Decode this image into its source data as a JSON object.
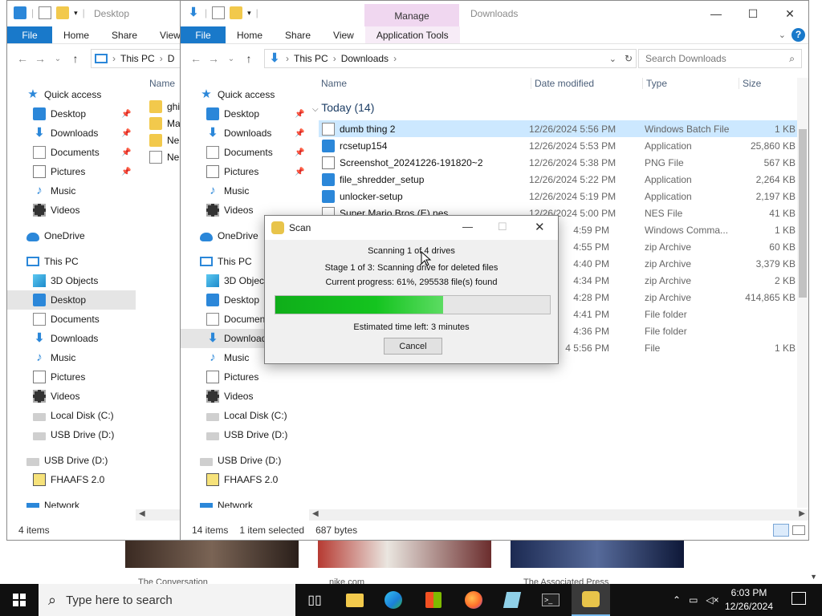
{
  "back_window": {
    "title": "Desktop",
    "ribbon": {
      "file": "File",
      "tabs": [
        "Home",
        "Share",
        "View"
      ]
    },
    "address": {
      "segments": [
        "This PC",
        "D"
      ]
    },
    "column_name": "Name",
    "files": [
      {
        "name": "ghi",
        "icon": "folder-icon"
      },
      {
        "name": "Ma",
        "icon": "folder-icon"
      },
      {
        "name": "Ne",
        "icon": "folder-icon"
      },
      {
        "name": "Ne",
        "icon": "document-icon"
      }
    ],
    "status": "4 items"
  },
  "front_window": {
    "title": "Downloads",
    "manage_label": "Manage",
    "ribbon": {
      "file": "File",
      "tabs": [
        "Home",
        "Share",
        "View",
        "Application Tools"
      ]
    },
    "address": {
      "segments": [
        "This PC",
        "Downloads"
      ]
    },
    "search_placeholder": "Search Downloads",
    "columns": {
      "name": "Name",
      "date": "Date modified",
      "type": "Type",
      "size": "Size"
    },
    "group_label": "Today (14)",
    "files": [
      {
        "name": "dumb thing 2",
        "date": "12/26/2024 5:56 PM",
        "type": "Windows Batch File",
        "size": "1 KB",
        "icon": "batch-file-icon",
        "selected": true
      },
      {
        "name": "rcsetup154",
        "date": "12/26/2024 5:53 PM",
        "type": "Application",
        "size": "25,860 KB",
        "icon": "setup-icon"
      },
      {
        "name": "Screenshot_20241226-191820~2",
        "date": "12/26/2024 5:38 PM",
        "type": "PNG File",
        "size": "567 KB",
        "icon": "image-file-icon"
      },
      {
        "name": "file_shredder_setup",
        "date": "12/26/2024 5:22 PM",
        "type": "Application",
        "size": "2,264 KB",
        "icon": "setup-icon"
      },
      {
        "name": "unlocker-setup",
        "date": "12/26/2024 5:19 PM",
        "type": "Application",
        "size": "2,197 KB",
        "icon": "setup-icon"
      },
      {
        "name": "Super Mario Bros (E).nes",
        "date": "12/26/2024 5:00 PM",
        "type": "NES File",
        "size": "41 KB",
        "icon": "document-icon"
      },
      {
        "name": "",
        "date": "4:59 PM",
        "type": "Windows Comma...",
        "size": "1 KB",
        "icon": "document-icon"
      },
      {
        "name": "",
        "date": "4:55 PM",
        "type": "zip Archive",
        "size": "60 KB",
        "icon": "zip-icon"
      },
      {
        "name": "",
        "date": "4:40 PM",
        "type": "zip Archive",
        "size": "3,379 KB",
        "icon": "zip-icon"
      },
      {
        "name": "",
        "date": "4:34 PM",
        "type": "zip Archive",
        "size": "2 KB",
        "icon": "zip-icon"
      },
      {
        "name": "",
        "date": "4:28 PM",
        "type": "zip Archive",
        "size": "414,865 KB",
        "icon": "zip-icon"
      },
      {
        "name": "",
        "date": "4:41 PM",
        "type": "File folder",
        "size": "",
        "icon": "folder-icon"
      },
      {
        "name": "",
        "date": "4:36 PM",
        "type": "File folder",
        "size": "",
        "icon": "folder-icon"
      },
      {
        "name": "",
        "date": "4 5:56 PM",
        "type": "File",
        "size": "1 KB",
        "icon": "document-icon"
      }
    ],
    "status": {
      "count": "14 items",
      "selected": "1 item selected",
      "size": "687 bytes"
    }
  },
  "sidebar_back": [
    {
      "label": "Quick access",
      "icon": "star-icon",
      "header": true
    },
    {
      "label": "Desktop",
      "icon": "desktop-icon",
      "pinned": true
    },
    {
      "label": "Downloads",
      "icon": "download-icon",
      "pinned": true
    },
    {
      "label": "Documents",
      "icon": "documents-icon",
      "pinned": true
    },
    {
      "label": "Pictures",
      "icon": "pictures-icon",
      "pinned": true
    },
    {
      "label": "Music",
      "icon": "music-icon"
    },
    {
      "label": "Videos",
      "icon": "videos-icon"
    },
    {
      "label": "",
      "spacer": true
    },
    {
      "label": "OneDrive",
      "icon": "cloud-icon",
      "header": true
    },
    {
      "label": "",
      "spacer": true
    },
    {
      "label": "This PC",
      "icon": "pc-icon",
      "header": true
    },
    {
      "label": "3D Objects",
      "icon": "cube-icon"
    },
    {
      "label": "Desktop",
      "icon": "desktop-icon",
      "selected": true
    },
    {
      "label": "Documents",
      "icon": "documents-icon"
    },
    {
      "label": "Downloads",
      "icon": "download-icon"
    },
    {
      "label": "Music",
      "icon": "music-icon"
    },
    {
      "label": "Pictures",
      "icon": "pictures-icon"
    },
    {
      "label": "Videos",
      "icon": "videos-icon"
    },
    {
      "label": "Local Disk (C:)",
      "icon": "disk-icon"
    },
    {
      "label": "USB Drive (D:)",
      "icon": "usb-icon"
    },
    {
      "label": "",
      "spacer": true
    },
    {
      "label": "USB Drive (D:)",
      "icon": "usb-icon",
      "header": true
    },
    {
      "label": "FHAAFS 2.0",
      "icon": "fhaafs-icon"
    },
    {
      "label": "",
      "spacer": true
    },
    {
      "label": "Network",
      "icon": "network-icon",
      "header": true
    }
  ],
  "sidebar_front": [
    {
      "label": "Quick access",
      "icon": "star-icon",
      "header": true
    },
    {
      "label": "Desktop",
      "icon": "desktop-icon",
      "pinned": true
    },
    {
      "label": "Downloads",
      "icon": "download-icon",
      "pinned": true
    },
    {
      "label": "Documents",
      "icon": "documents-icon",
      "pinned": true
    },
    {
      "label": "Pictures",
      "icon": "pictures-icon",
      "pinned": true
    },
    {
      "label": "Music",
      "icon": "music-icon"
    },
    {
      "label": "Videos",
      "icon": "videos-icon"
    },
    {
      "label": "",
      "spacer": true
    },
    {
      "label": "OneDrive",
      "icon": "cloud-icon",
      "header": true
    },
    {
      "label": "",
      "spacer": true
    },
    {
      "label": "This PC",
      "icon": "pc-icon",
      "header": true
    },
    {
      "label": "3D Object",
      "icon": "cube-icon"
    },
    {
      "label": "Desktop",
      "icon": "desktop-icon"
    },
    {
      "label": "Documen",
      "icon": "documents-icon"
    },
    {
      "label": "Download",
      "icon": "download-icon",
      "selected": true
    },
    {
      "label": "Music",
      "icon": "music-icon"
    },
    {
      "label": "Pictures",
      "icon": "pictures-icon"
    },
    {
      "label": "Videos",
      "icon": "videos-icon"
    },
    {
      "label": "Local Disk (C:)",
      "icon": "disk-icon"
    },
    {
      "label": "USB Drive (D:)",
      "icon": "usb-icon"
    },
    {
      "label": "",
      "spacer": true
    },
    {
      "label": "USB Drive (D:)",
      "icon": "usb-icon",
      "header": true
    },
    {
      "label": "FHAAFS 2.0",
      "icon": "fhaafs-icon"
    },
    {
      "label": "",
      "spacer": true
    },
    {
      "label": "Network",
      "icon": "network-icon",
      "header": true
    }
  ],
  "dialog": {
    "title": "Scan",
    "line1": "Scanning 1 of 4 drives",
    "line2": "Stage 1 of 3: Scanning drive for deleted files",
    "line3": "Current progress: 61%, 295538 file(s) found",
    "progress_fraction": 0.61,
    "eta": "Estimated time left: 3 minutes",
    "cancel": "Cancel"
  },
  "web_captions": [
    "The Conversation",
    "nike.com",
    "The Associated Press"
  ],
  "taskbar": {
    "search_placeholder": "Type here to search",
    "apps": [
      "task-view-icon",
      "file-explorer-icon",
      "edge-icon",
      "store-icon",
      "firefox-icon",
      "notepad-icon",
      "terminal-icon",
      "scan-app-icon"
    ],
    "time": "6:03 PM",
    "date": "12/26/2024"
  },
  "colors": {
    "accent": "#1979ca",
    "progress": "#14c41f",
    "manage_tab": "#f0d7f0"
  }
}
